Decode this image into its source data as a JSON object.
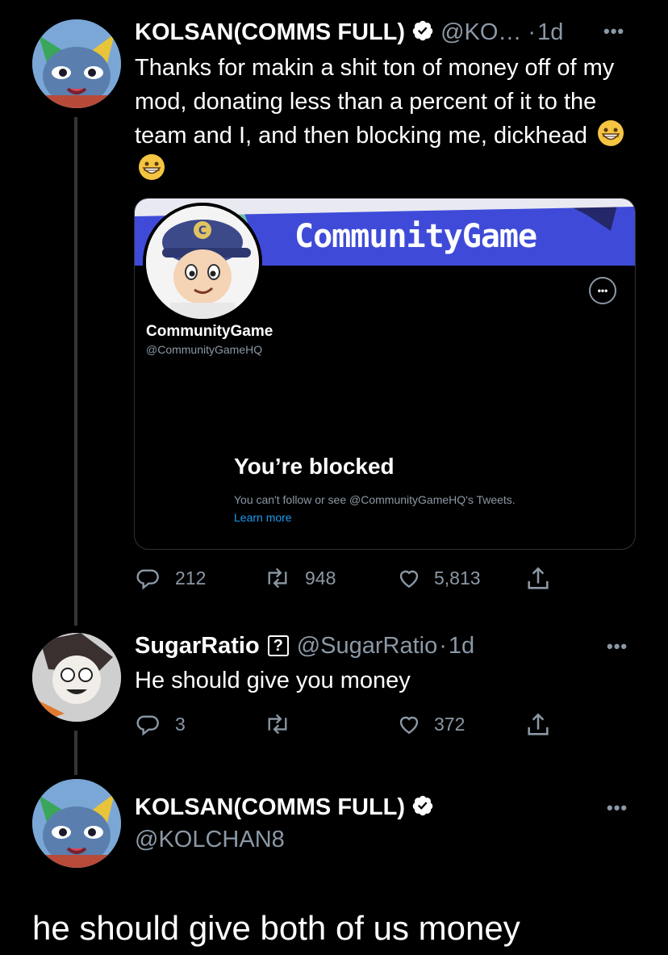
{
  "tweet1": {
    "name": "KOLSAN(COMMS FULL)",
    "handle": "@KO…",
    "separator": "·",
    "time": "1d",
    "text": "Thanks for makin a shit ton of money off of my mod, donating less than a percent of it to the team and I, and then blocking me, dickhead",
    "emojis": [
      "grinning-face-emoji",
      "grinning-face-emoji"
    ],
    "card": {
      "banner_text": "CommunityGame",
      "profile_name": "CommunityGame",
      "profile_handle": "@CommunityGameHQ",
      "blocked_title": "You’re blocked",
      "blocked_desc": "You can't follow or see @CommunityGameHQ's Tweets.",
      "learn_more": "Learn more",
      "banner_color": "#3f4bd8"
    },
    "stats": {
      "replies": "212",
      "retweets": "948",
      "likes": "5,813"
    }
  },
  "tweet2": {
    "name": "SugarRatio",
    "badge": "?",
    "handle": "@SugarRatio",
    "separator": "·",
    "time": "1d",
    "text": "He should give you money",
    "stats": {
      "replies": "3",
      "retweets": "",
      "likes": "372"
    }
  },
  "tweet3": {
    "name": "KOLSAN(COMMS FULL)",
    "handle": "@KOLCHAN8",
    "text": "he should give both of us money"
  },
  "colors": {
    "background": "#000000",
    "muted": "#8b98a5",
    "link": "#1d9bf0",
    "thread_line": "#333639"
  }
}
